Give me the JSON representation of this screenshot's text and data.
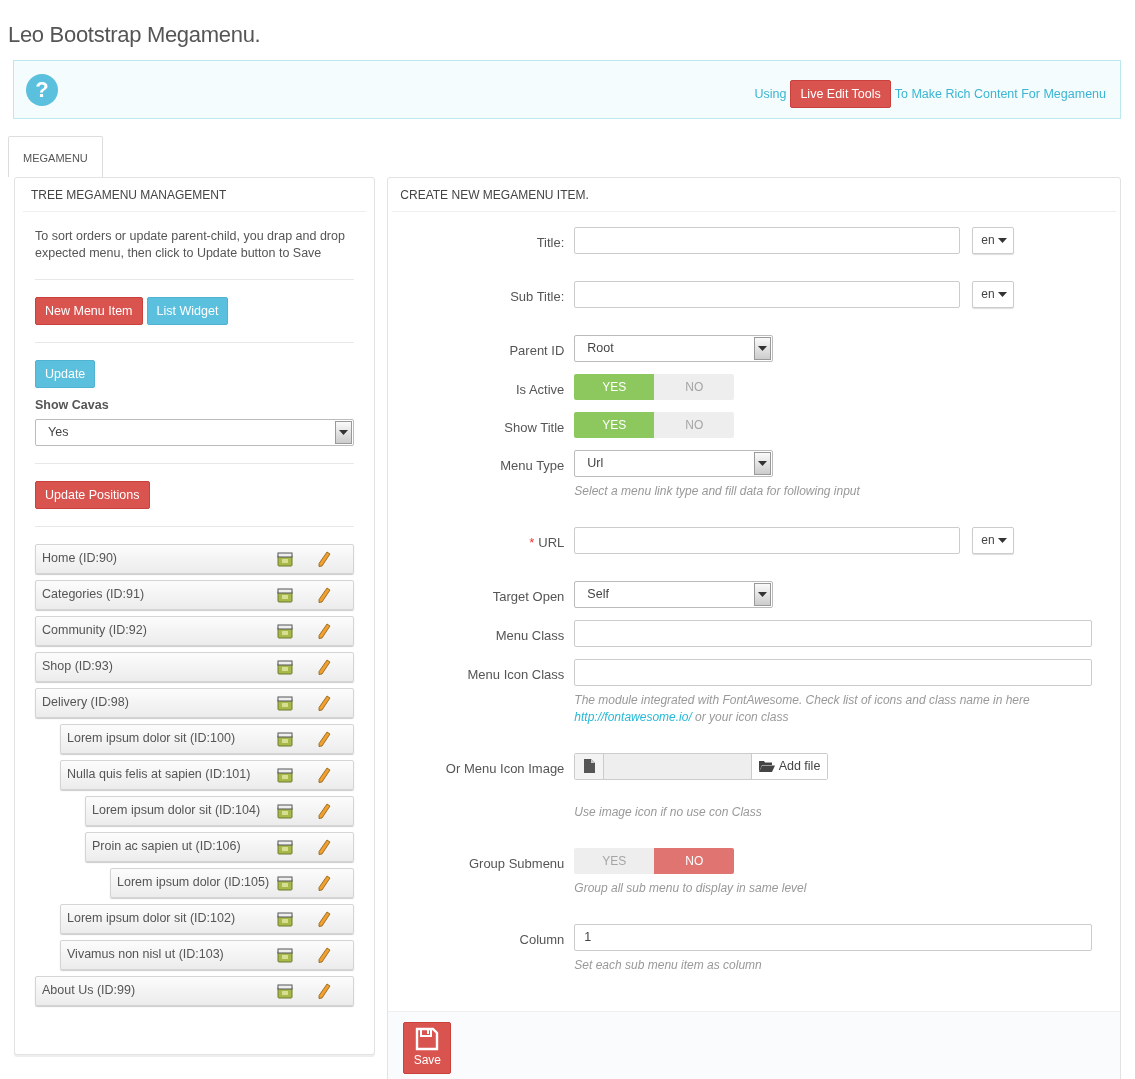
{
  "page_title": "Leo Bootstrap Megamenu.",
  "banner": {
    "icon": "?",
    "before": "Using",
    "button": "Live Edit Tools",
    "after": "To Make Rich Content For Megamenu"
  },
  "tabs": [
    {
      "label": "MEGAMENU",
      "selected": true
    }
  ],
  "tree_panel": {
    "title": "TREE MEGAMENU MANAGEMENT",
    "description": "To sort orders or update parent-child, you drap and drop expected menu, then click to Update button to Save",
    "buttons": [
      {
        "label": "New Menu Item",
        "kind": "danger"
      },
      {
        "label": "List Widget",
        "kind": "info"
      }
    ],
    "update_button": "Update",
    "show_cavas": {
      "label": "Show Cavas",
      "value": "Yes"
    },
    "positions_button": "Update Positions",
    "items": [
      {
        "label": "Home (ID:90)"
      },
      {
        "label": "Categories (ID:91)"
      },
      {
        "label": "Community (ID:92)"
      },
      {
        "label": "Shop (ID:93)"
      },
      {
        "label": "Delivery (ID:98)",
        "children": [
          {
            "label": "Lorem ipsum dolor sit (ID:100)"
          },
          {
            "label": "Nulla quis felis at sapien (ID:101)",
            "children": [
              {
                "label": "Lorem ipsum dolor sit (ID:104)"
              },
              {
                "label": "Proin ac sapien ut (ID:106)",
                "children": [
                  {
                    "label": "Lorem ipsum dolor (ID:105)"
                  }
                ]
              }
            ]
          },
          {
            "label": "Lorem ipsum dolor sit (ID:102)"
          },
          {
            "label": "Vivamus non nisl ut (ID:103)"
          }
        ]
      },
      {
        "label": "About Us (ID:99)"
      }
    ]
  },
  "form_panel": {
    "title": "CREATE NEW MEGAMENU ITEM.",
    "fields": [
      {
        "kind": "text",
        "label": "Title:",
        "lang": "en"
      },
      {
        "kind": "text",
        "label": "Sub Title:",
        "lang": "en"
      },
      {
        "kind": "select",
        "label": "Parent ID",
        "value": "Root"
      },
      {
        "kind": "toggle",
        "label": "Is Active",
        "yes": "YES",
        "no": "NO",
        "on": true
      },
      {
        "kind": "toggle",
        "label": "Show Title",
        "yes": "YES",
        "no": "NO",
        "on": true
      },
      {
        "kind": "select",
        "label": "Menu Type",
        "value": "Url",
        "help": "Select a menu link type and fill data for following input"
      },
      {
        "kind": "text",
        "label": "URL",
        "lang": "en",
        "required": true,
        "required_mark": "*"
      },
      {
        "kind": "select",
        "label": "Target Open",
        "value": "Self"
      },
      {
        "kind": "text",
        "label": "Menu Class"
      },
      {
        "kind": "text",
        "label": "Menu Icon Class",
        "help": "The module integrated with FontAwesome. Check list of icons and class name in here",
        "help_link": "http://fontawesome.io/",
        "help_after": "or your icon class"
      },
      {
        "kind": "file",
        "label": "Or Menu Icon Image",
        "button": "Add file",
        "help": "Use image icon if no use con Class"
      },
      {
        "kind": "toggle",
        "label": "Group Submenu",
        "yes": "YES",
        "no": "NO",
        "on": false,
        "help": "Group all sub menu to display in same level"
      },
      {
        "kind": "text",
        "label": "Column",
        "value": "1",
        "help": "Set each sub menu item as column"
      }
    ],
    "save_button": "Save"
  }
}
